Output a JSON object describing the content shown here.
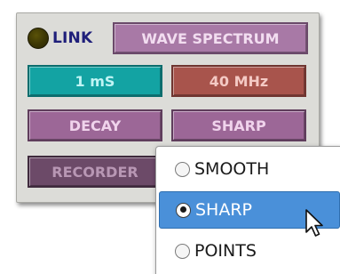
{
  "panel": {
    "led": {
      "color": "#3b3604",
      "state": "off"
    },
    "link_label": "LINK",
    "title_button": "WAVE SPECTRUM",
    "time_button": "1 mS",
    "freq_button": "40 MHz",
    "decay_button": "DECAY",
    "mode_button": "SHARP",
    "recorder_button": "RECORDER"
  },
  "mode_menu": {
    "items": [
      {
        "label": "SMOOTH",
        "checked": false,
        "highlighted": false
      },
      {
        "label": "SHARP",
        "checked": true,
        "highlighted": true
      },
      {
        "label": "POINTS",
        "checked": false,
        "highlighted": false
      }
    ]
  },
  "cursor": {
    "icon": "arrow-pointer-icon"
  },
  "colors": {
    "title": "#a879a6",
    "time": "#13a3a3",
    "freq": "#a8544c",
    "decay": "#9c6797",
    "recorder": "#6c4a68",
    "menu_highlight": "#4a90d9",
    "link_text": "#1f1f7a"
  }
}
